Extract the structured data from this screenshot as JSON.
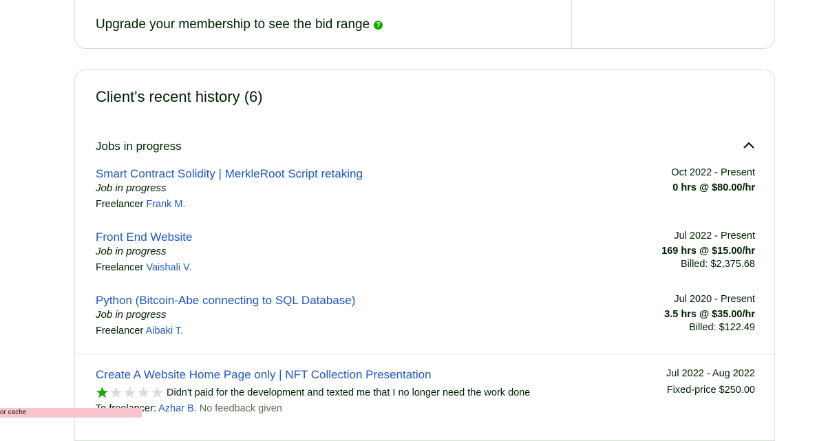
{
  "membership": {
    "upgrade_text": "Upgrade your membership to see the bid range",
    "help_icon": "?"
  },
  "history": {
    "title": "Client's recent history (6)",
    "section_title": "Jobs in progress",
    "jobs": [
      {
        "title": "Smart Contract Solidity | MerkleRoot Script retaking",
        "status": "Job in progress",
        "freelancer_prefix": "Freelancer",
        "freelancer_name": "Frank M.",
        "dates": "Oct 2022 - Present",
        "rate": "0 hrs @ $80.00/hr",
        "billed": ""
      },
      {
        "title": "Front End Website",
        "status": "Job in progress",
        "freelancer_prefix": "Freelancer",
        "freelancer_name": "Vaishali V.",
        "dates": "Jul 2022 - Present",
        "rate": "169 hrs @ $15.00/hr",
        "billed": "Billed: $2,375.68"
      },
      {
        "title": "Python (Bitcoin-Abe connecting to SQL Database)",
        "status": "Job in progress",
        "freelancer_prefix": "Freelancer",
        "freelancer_name": "Aibaki T.",
        "dates": "Jul 2020 - Present",
        "rate": "3.5 hrs @ $35.00/hr",
        "billed": "Billed: $122.49"
      }
    ],
    "completed": [
      {
        "title": "Create A Website Home Page only | NFT Collection Presentation",
        "rating": 1,
        "rating_max": 5,
        "feedback": "Didn't paid for the development and texted me that I no longer need the work done",
        "to_freelancer_prefix": "To freelancer:",
        "freelancer_name": "Azhar B.",
        "freelancer_feedback": "No feedback given",
        "dates": "Jul 2022 - Aug 2022",
        "price": "Fixed-price $250.00"
      }
    ]
  },
  "overlay": {
    "bar_text": "or cache"
  },
  "colors": {
    "link": "#1f57c3",
    "accent": "#14a800",
    "star_off": "#d5e0d5",
    "border": "#d5e0d5"
  }
}
